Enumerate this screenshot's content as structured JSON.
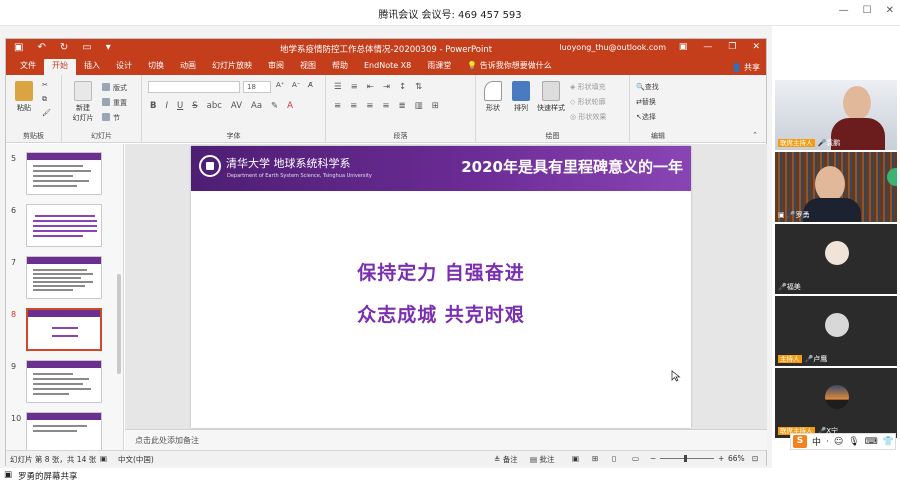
{
  "meeting": {
    "title": "腾讯会议 会议号: 469 457 593",
    "share_status": "罗勇的屏幕共享"
  },
  "ppt": {
    "doc_title": "地学系疫情防控工作总体情况-20200309 - PowerPoint",
    "account": "luoyong_thu@outlook.com",
    "tabs": [
      "文件",
      "开始",
      "插入",
      "设计",
      "切换",
      "动画",
      "幻灯片放映",
      "审阅",
      "视图",
      "帮助",
      "EndNote X8",
      "雨课堂"
    ],
    "active_tab": "开始",
    "tell_me": "告诉我你想要做什么",
    "share_label": "共享",
    "ribbon": {
      "paste": "粘贴",
      "clipboard": "剪贴板",
      "new_slide": "新建\n幻灯片",
      "layout": "版式",
      "reset": "重置",
      "section": "节",
      "slides_group": "幻灯片",
      "font_size": "18",
      "font_group": "字体",
      "paragraph_group": "段落",
      "shape": "形状",
      "arrange": "排列",
      "quick_styles": "快速样式",
      "shape_fill": "形状填充",
      "shape_outline": "形状轮廓",
      "shape_effects": "形状效果",
      "drawing_group": "绘图",
      "find": "查找",
      "replace": "替换",
      "select": "选择",
      "editing_group": "编辑"
    },
    "thumb_numbers": [
      "5",
      "6",
      "7",
      "8",
      "9",
      "10"
    ],
    "active_slide_index": 3,
    "slide": {
      "school": "清华大学 地球系统科学系",
      "dept_en": "Department of Earth System Science, Tsinghua University",
      "heading": "2020年是具有里程碑意义的一年",
      "line1": "保持定力 自强奋进",
      "line2": "众志成城 共克时艰"
    },
    "notes_placeholder": "点击此处添加备注",
    "status": {
      "slide_info": "幻灯片 第 8 张，共 14 张",
      "language": "中文(中国)",
      "notes": "备注",
      "comments": "批注",
      "zoom": "66%"
    }
  },
  "participants": [
    {
      "name": "袁鹏",
      "host": true,
      "host_label": "联席主持人"
    },
    {
      "name": "罗勇",
      "host": false
    },
    {
      "name": "福美",
      "host": false
    },
    {
      "name": "卢鹰",
      "host": true,
      "host_label": "主持人"
    },
    {
      "name": "X宁",
      "host": true,
      "host_label": "联席主持人"
    }
  ],
  "ime": {
    "lang": "中"
  }
}
